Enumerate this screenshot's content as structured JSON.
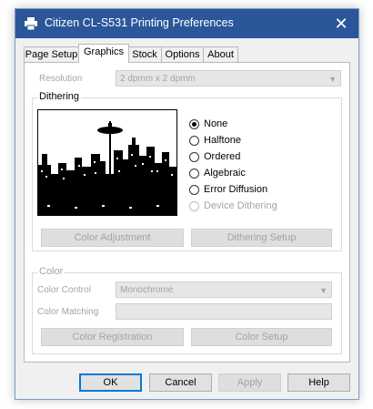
{
  "window": {
    "title": "Citizen CL-S531 Printing Preferences",
    "close_glyph": "✕"
  },
  "tabs": [
    {
      "label": "Page Setup"
    },
    {
      "label": "Graphics"
    },
    {
      "label": "Stock"
    },
    {
      "label": "Options"
    },
    {
      "label": "About"
    }
  ],
  "active_tab": "Graphics",
  "resolution": {
    "label": "Resolution",
    "value": "2 dpmm x 2 dpmm"
  },
  "dithering": {
    "legend": "Dithering",
    "options": [
      {
        "label": "None",
        "selected": true,
        "enabled": true
      },
      {
        "label": "Halftone",
        "selected": false,
        "enabled": true
      },
      {
        "label": "Ordered",
        "selected": false,
        "enabled": true
      },
      {
        "label": "Algebraic",
        "selected": false,
        "enabled": true
      },
      {
        "label": "Error Diffusion",
        "selected": false,
        "enabled": true
      },
      {
        "label": "Device Dithering",
        "selected": false,
        "enabled": false
      }
    ],
    "color_adjustment_button": "Color Adjustment",
    "dithering_setup_button": "Dithering Setup"
  },
  "color": {
    "legend": "Color",
    "control_label": "Color Control",
    "control_value": "Monochrome",
    "matching_label": "Color Matching",
    "matching_value": "",
    "registration_button": "Color Registration",
    "setup_button": "Color Setup"
  },
  "footer": {
    "ok": "OK",
    "cancel": "Cancel",
    "apply": "Apply",
    "help": "Help"
  },
  "colors": {
    "titlebar": "#2b579a",
    "ok_border": "#0078d7",
    "disabled_text": "#a4a4a4"
  }
}
